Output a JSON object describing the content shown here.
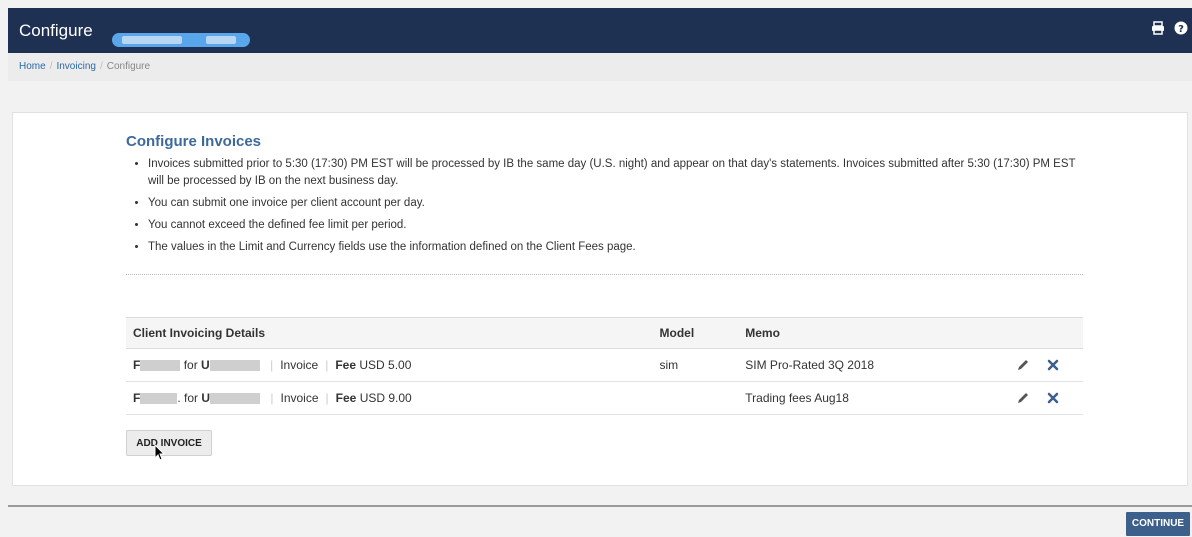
{
  "header": {
    "title": "Configure",
    "icons": [
      "print-icon",
      "help-icon"
    ]
  },
  "breadcrumb": {
    "items": [
      "Home",
      "Invoicing"
    ],
    "current": "Configure"
  },
  "main": {
    "section_title": "Configure Invoices",
    "notes": [
      "Invoices submitted prior to 5:30 (17:30) PM EST will be processed by IB the same day (U.S. night) and appear on that day's statements. Invoices submitted after 5:30 (17:30) PM EST will be processed by IB on the next business day.",
      "You can submit one invoice per client account per day.",
      "You cannot exceed the defined fee limit per period.",
      "The values in the Limit and Currency fields use the information defined on the Client Fees page."
    ],
    "table": {
      "headers": [
        "Client Invoicing Details",
        "Model",
        "Memo"
      ],
      "rows": [
        {
          "from_prefix": "F",
          "for_label": "for",
          "to_prefix": "U",
          "type": "Invoice",
          "fee_label": "Fee",
          "fee_value": "USD 5.00",
          "model": "sim",
          "memo": "SIM Pro-Rated 3Q 2018"
        },
        {
          "from_prefix": "F",
          "for_label": ". for",
          "to_prefix": "U",
          "type": "Invoice",
          "fee_label": "Fee",
          "fee_value": "USD 9.00",
          "model": "",
          "memo": "Trading fees Aug18"
        }
      ]
    },
    "add_button": "ADD INVOICE"
  },
  "footer": {
    "continue_button": "CONTINUE"
  },
  "colors": {
    "topbar": "#1e3153",
    "link": "#2a6aa8",
    "title": "#3d6a9b",
    "continue": "#3d5f8c"
  }
}
